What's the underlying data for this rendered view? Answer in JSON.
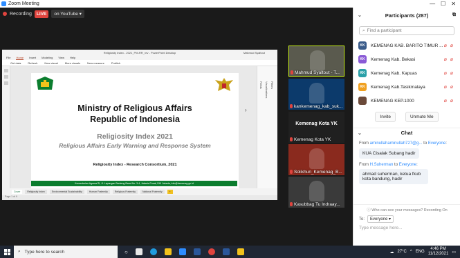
{
  "window": {
    "title": "Zoom Meeting",
    "minimize": "—",
    "maximize": "☐",
    "close": "✕"
  },
  "recording": {
    "label": "Recording",
    "live": "LIVE",
    "stream": "on YouTube"
  },
  "ppt": {
    "title": "Religiosity Index - 2021_PM-RR_rev - PowerPoint Desktop",
    "user": "Mahmud Syaltout",
    "tabs": [
      "File",
      "Home",
      "Insert",
      "Modeling",
      "View",
      "Help"
    ],
    "active_tab": "Home",
    "ribbon": [
      "Get data",
      "Refresh",
      "New visual",
      "More visuals",
      "New measure",
      "Publish"
    ],
    "right_labels": [
      "Fields",
      "Visualizations",
      "Filters"
    ],
    "sheet_tabs": [
      "Cover",
      "Religiosity Index",
      "Environmental Sustainability",
      "Human Fraternity",
      "Religious Fraternity",
      "National Fraternity",
      "+"
    ],
    "status": "Page 1 of 9"
  },
  "slide": {
    "title_line1": "Ministry of Religious Affairs",
    "title_line2": "Republic of Indonesia",
    "subtitle1": "Religiosity Index 2021",
    "subtitle2": "Religious Affairs Early Warning and Response System",
    "consortium": "Religiosity Index - Research Consortium, 2021",
    "footer": "Kementerian Agama RI, Jl. Lapangan Banteng Barat No. 3-4, Jakarta Pusat, DKI Jakarta, info@kemenag.go.id"
  },
  "videos": [
    {
      "name": "Mahmud Syaltout - T...",
      "bg": "#5a5a4e",
      "border": "#c9f21b"
    },
    {
      "name": "kankemenag_kab_suk...",
      "bg": "#0c3a6b",
      "border": "none"
    },
    {
      "name": "Kemenag Kota YK",
      "bg": "#202020",
      "border": "none",
      "center": "Kemenag Kota YK"
    },
    {
      "name": "Solikhun_Kemenag_B...",
      "bg": "#8a2a1e",
      "border": "none"
    },
    {
      "name": "Kasubbag Tu Indraay...",
      "bg": "#3a3a3a",
      "border": "none"
    }
  ],
  "participants": {
    "header": "Participants (287)",
    "search_placeholder": "Find a participant",
    "rows": [
      {
        "initials": "KK",
        "name": "KEMENAG KAB. BARITO TIMUR ...",
        "color": "#3a5b8a"
      },
      {
        "initials": "KK",
        "name": "Kemenag Kab. Bekasi",
        "color": "#8a5ad6"
      },
      {
        "initials": "KK",
        "name": "Kemenag Kab. Kapuas",
        "color": "#2aa0a8"
      },
      {
        "initials": "KK",
        "name": "Kemenag Kab.Tasikmalaya",
        "color": "#f0a020"
      },
      {
        "initials": "",
        "name": "KEMENAG KEP.1000",
        "color": "#6b4a3a"
      }
    ],
    "invite": "Invite",
    "unmute_me": "Unmute Me"
  },
  "chat": {
    "header": "Chat",
    "messages": [
      {
        "from": "aminullahaminullah727@g...",
        "to": "Everyone",
        "text": "KUA Cisalak Subang hadir"
      },
      {
        "from": "H.Suherman",
        "to": "Everyone",
        "text": "ahmad suherman, ketua fkub kota bandung, hadir"
      }
    ],
    "privacy": "Who can see your messages? Recording On",
    "to_label": "To:",
    "to_value": "Everyone",
    "input_placeholder": "Type message here..."
  },
  "taskbar": {
    "search_placeholder": "Type here to search",
    "weather": "27°C",
    "time": "4:46 PM",
    "date": "11/12/2021",
    "lang": "ENG"
  }
}
